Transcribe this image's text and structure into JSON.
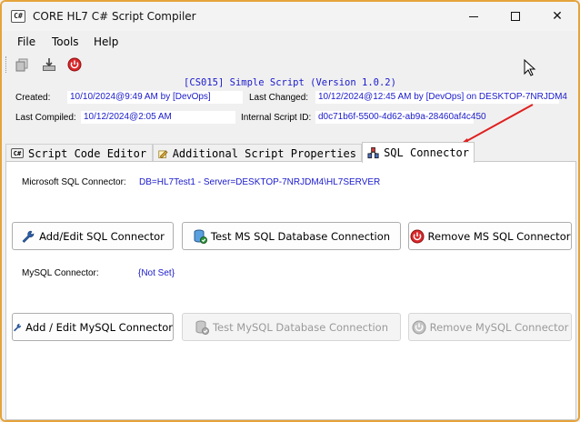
{
  "window": {
    "title": "CORE HL7 C# Script Compiler",
    "icon_text": "C#",
    "controls": {
      "minimize": "minimize-icon",
      "maximize": "maximize-icon",
      "close": "close-icon"
    }
  },
  "menu": [
    "File",
    "Tools",
    "Help"
  ],
  "toolbar": {
    "icons": [
      "copy-icon",
      "download-icon",
      "power-icon"
    ]
  },
  "script": {
    "title": "[CS015] Simple Script (Version 1.0.2)",
    "created_label": "Created:",
    "created_value": "10/10/2024@9:49 AM by [DevOps]",
    "last_changed_label": "Last Changed:",
    "last_changed_value": "10/12/2024@12:45 AM by [DevOps] on DESKTOP-7NRJDM4",
    "last_compiled_label": "Last Compiled:",
    "last_compiled_value": "10/12/2024@2:05 AM",
    "internal_id_label": "Internal Script ID:",
    "internal_id_value": "d0c71b6f-5500-4d62-ab9a-28460af4c450"
  },
  "tabs": [
    {
      "label": "Script Code Editor",
      "icon": "csharp-icon",
      "icon_text": "C#",
      "active": false
    },
    {
      "label": "Additional Script Properties",
      "icon": "properties-icon",
      "active": false
    },
    {
      "label": "SQL Connector",
      "icon": "sql-connector-icon",
      "active": true
    }
  ],
  "sql_connector": {
    "mssql_label": "Microsoft SQL Connector:",
    "mssql_value": "DB=HL7Test1 - Server=DESKTOP-7NRJDM4\\HL7SERVER",
    "mysql_label": "MySQL Connector:",
    "mysql_value": "{Not Set}",
    "buttons": {
      "add_edit_sql": "Add/Edit SQL Connector",
      "test_ms_sql": "Test MS SQL Database Connection",
      "remove_ms_sql": "Remove MS SQL Connector",
      "add_edit_mysql": "Add / Edit MySQL Connector",
      "test_mysql": "Test MySQL Database Connection",
      "remove_mysql": "Remove MySQL Connector"
    }
  },
  "colors": {
    "window_border": "#e5a33a",
    "value_text": "#1a1acc",
    "annotation_arrow": "#e02020"
  }
}
